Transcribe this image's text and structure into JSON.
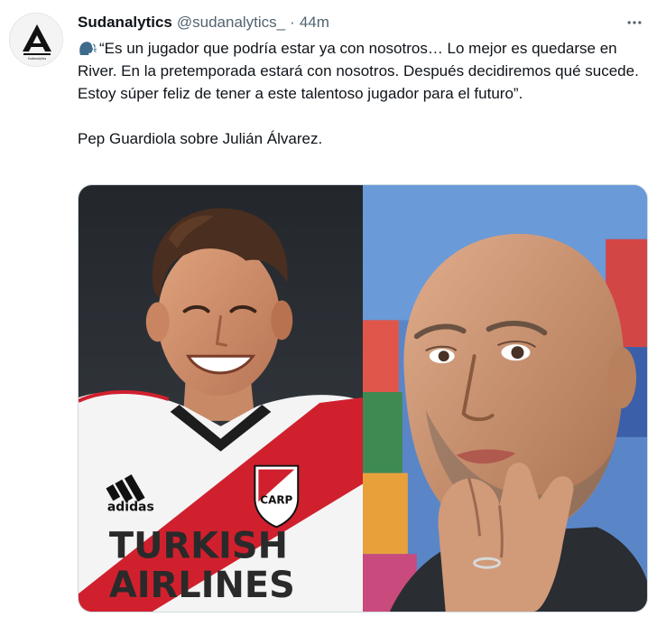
{
  "author": {
    "display_name": "Sudanalytics",
    "handle": "@sudanalytics_",
    "separator": "·",
    "time": "44m",
    "avatar_letter": "A"
  },
  "tweet": {
    "quote": "“Es un jugador que podría estar ya con nosotros… Lo mejor es quedarse en River. En la pretemporada estará con nosotros. Después decidiremos qué sucede. Estoy súper feliz de tener a este talentoso jugador para el futuro”.",
    "attribution": "Pep Guardiola sobre Julián Álvarez.",
    "emoji": "speaking-head-icon"
  },
  "media": {
    "left_photo": {
      "subject": "player-photo",
      "shirt_brand": "adidas",
      "sponsor_line1": "TURKISH",
      "sponsor_line2": "AIRLINES",
      "crest_text": "CARP"
    },
    "right_photo": {
      "subject": "coach-photo"
    }
  },
  "colors": {
    "text": "#0f1419",
    "muted": "#536471",
    "border": "#cfd9de",
    "river_red": "#d0202e"
  },
  "icons": {
    "more": "more-options-icon"
  }
}
